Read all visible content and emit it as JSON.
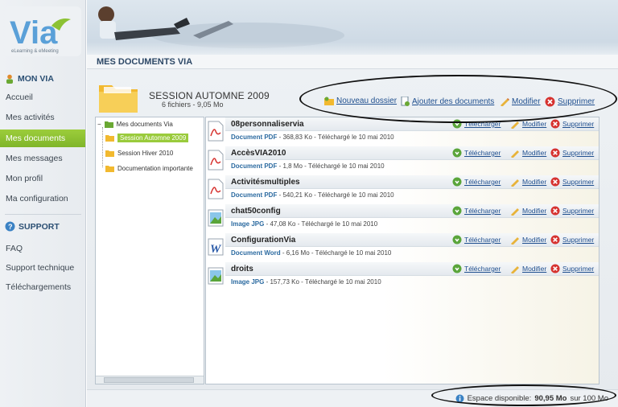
{
  "brand": {
    "logo_text": "Via",
    "tagline": "eLearning & eMeeting"
  },
  "sidebar": {
    "section1_title": "MON VIA",
    "items": [
      {
        "label": "Accueil"
      },
      {
        "label": "Mes activités"
      },
      {
        "label": "Mes documents"
      },
      {
        "label": "Mes messages"
      },
      {
        "label": "Mon profil"
      },
      {
        "label": "Ma configuration"
      }
    ],
    "section2_title": "SUPPORT",
    "support_items": [
      {
        "label": "FAQ"
      },
      {
        "label": "Support technique"
      },
      {
        "label": "Téléchargements"
      }
    ]
  },
  "page": {
    "title": "MES DOCUMENTS VIA"
  },
  "session": {
    "title": "SESSION AUTOMNE 2009",
    "meta": "6 fichiers - 9,05 Mo",
    "actions": {
      "new_folder": "Nouveau dossier",
      "add_docs": "Ajouter des documents",
      "edit": "Modifier",
      "delete": "Supprimer"
    }
  },
  "tree": {
    "root": "Mes documents Via",
    "folders": [
      {
        "label": "Session Automne 2009"
      },
      {
        "label": "Session Hiver 2010"
      },
      {
        "label": "Documentation importante"
      }
    ]
  },
  "files": {
    "action_download": "Télécharger",
    "action_edit": "Modifier",
    "action_delete": "Supprimer",
    "items": [
      {
        "name": "08personnaliservia",
        "type": "Document PDF",
        "detail": " - 368,83 Ko - Téléchargé le 10 mai 2010",
        "icon": "pdf-icon"
      },
      {
        "name": "AccèsVIA2010",
        "type": "Document PDF",
        "detail": " - 1,8 Mo - Téléchargé le 10 mai 2010",
        "icon": "pdf-icon"
      },
      {
        "name": "Activitésmultiples",
        "type": "Document PDF",
        "detail": " - 540,21 Ko - Téléchargé le 10 mai 2010",
        "icon": "pdf-icon"
      },
      {
        "name": "chat50config",
        "type": "Image JPG",
        "detail": " - 47,08 Ko - Téléchargé le 10 mai 2010",
        "icon": "image-icon"
      },
      {
        "name": "ConfigurationVia",
        "type": "Document Word",
        "detail": " - 6,16 Mo - Téléchargé le 10 mai 2010",
        "icon": "word-icon"
      },
      {
        "name": "droits",
        "type": "Image JPG",
        "detail": " - 157,73 Ko - Téléchargé le 10 mai 2010",
        "icon": "image-icon"
      }
    ]
  },
  "footer": {
    "space_label": "Espace disponible:",
    "space_value": "90,95 Mo",
    "space_total": " sur 100 Mo"
  },
  "colors": {
    "accent_green": "#8cc234",
    "link_blue": "#1f4f8f",
    "title_blue": "#2d4866"
  }
}
